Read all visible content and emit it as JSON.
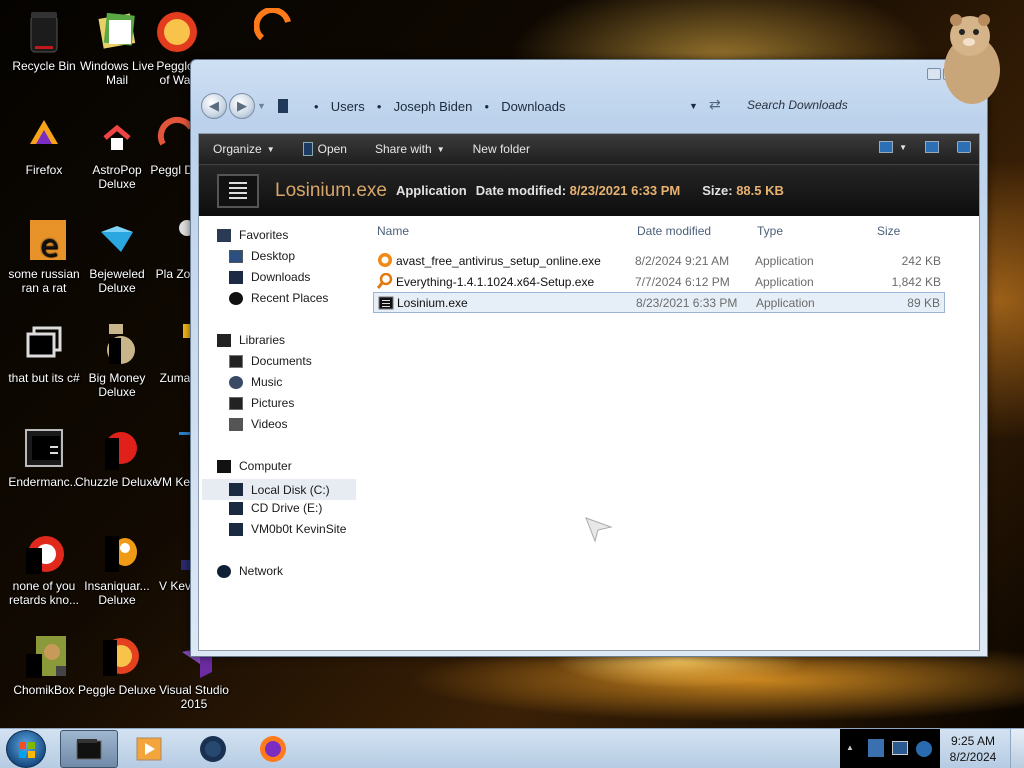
{
  "desktop": {
    "icons": [
      {
        "label": "Recycle Bin",
        "icon": "recycle-bin-icon"
      },
      {
        "label": "Windows Live Mail",
        "icon": "mail-icon"
      },
      {
        "label": "Pegglo of Wa",
        "icon": "peggle-icon"
      },
      {
        "label": "Firefox",
        "icon": "firefox-icon"
      },
      {
        "label": "AstroPop Deluxe",
        "icon": "astropop-icon"
      },
      {
        "label": "Peggl De",
        "icon": "peggle-icon"
      },
      {
        "label": "some russian ran a rat",
        "icon": "rat-icon"
      },
      {
        "label": "Bejeweled Deluxe",
        "icon": "gem-icon"
      },
      {
        "label": "Pla Zor",
        "icon": "game-icon"
      },
      {
        "label": "that but its c#",
        "icon": "window-stack-icon"
      },
      {
        "label": "Big Money Deluxe",
        "icon": "money-icon"
      },
      {
        "label": "Zuma",
        "icon": "zuma-icon"
      },
      {
        "label": "Endermanc...",
        "icon": "terminal-icon"
      },
      {
        "label": "Chuzzle Deluxe",
        "icon": "chuzzle-icon"
      },
      {
        "label": "VM Kev",
        "icon": "vm-icon"
      },
      {
        "label": "none of you retards kno...",
        "icon": "chrome-icon"
      },
      {
        "label": "Insaniquar... Deluxe",
        "icon": "fish-icon"
      },
      {
        "label": "V Kev",
        "icon": "vm-icon"
      },
      {
        "label": "ChomikBox",
        "icon": "hamster-icon"
      },
      {
        "label": "Peggle Deluxe",
        "icon": "peggle-icon"
      },
      {
        "label": "Visual Studio 2015",
        "icon": "visual-studio-icon"
      }
    ]
  },
  "explorer": {
    "breadcrumb": [
      "Users",
      "Joseph Biden",
      "Downloads"
    ],
    "search_placeholder": "Search Downloads",
    "toolbar": {
      "organize": "Organize",
      "open": "Open",
      "share_with": "Share with",
      "new_folder": "New folder"
    },
    "details": {
      "name": "Losinium.exe",
      "type": "Application",
      "date_label": "Date modified:",
      "date_value": "8/23/2021 6:33 PM",
      "size_label": "Size:",
      "size_value": "88.5 KB"
    },
    "nav": {
      "favorites": "Favorites",
      "desktop": "Desktop",
      "downloads": "Downloads",
      "recent": "Recent Places",
      "libraries": "Libraries",
      "documents": "Documents",
      "music": "Music",
      "pictures": "Pictures",
      "videos": "Videos",
      "computer": "Computer",
      "local_disk": "Local Disk (C:)",
      "cd_drive": "CD Drive (E:)",
      "vm_site": "VM0b0t KevinSite",
      "network": "Network"
    },
    "columns": {
      "name": "Name",
      "date": "Date modified",
      "type": "Type",
      "size": "Size"
    },
    "files": [
      {
        "name": "avast_free_antivirus_setup_online.exe",
        "date": "8/2/2024 9:21 AM",
        "type": "Application",
        "size": "242 KB",
        "icon": "avast-icon"
      },
      {
        "name": "Everything-1.4.1.1024.x64-Setup.exe",
        "date": "7/7/2024 6:12 PM",
        "type": "Application",
        "size": "1,842 KB",
        "icon": "everything-search-icon"
      },
      {
        "name": "Losinium.exe",
        "date": "8/23/2021 6:33 PM",
        "type": "Application",
        "size": "89 KB",
        "icon": "exe-icon"
      }
    ]
  },
  "taskbar": {
    "time": "9:25 AM",
    "date": "8/2/2024"
  },
  "colors": {
    "accent": "#e8b271",
    "selection": "#e6eef8"
  }
}
